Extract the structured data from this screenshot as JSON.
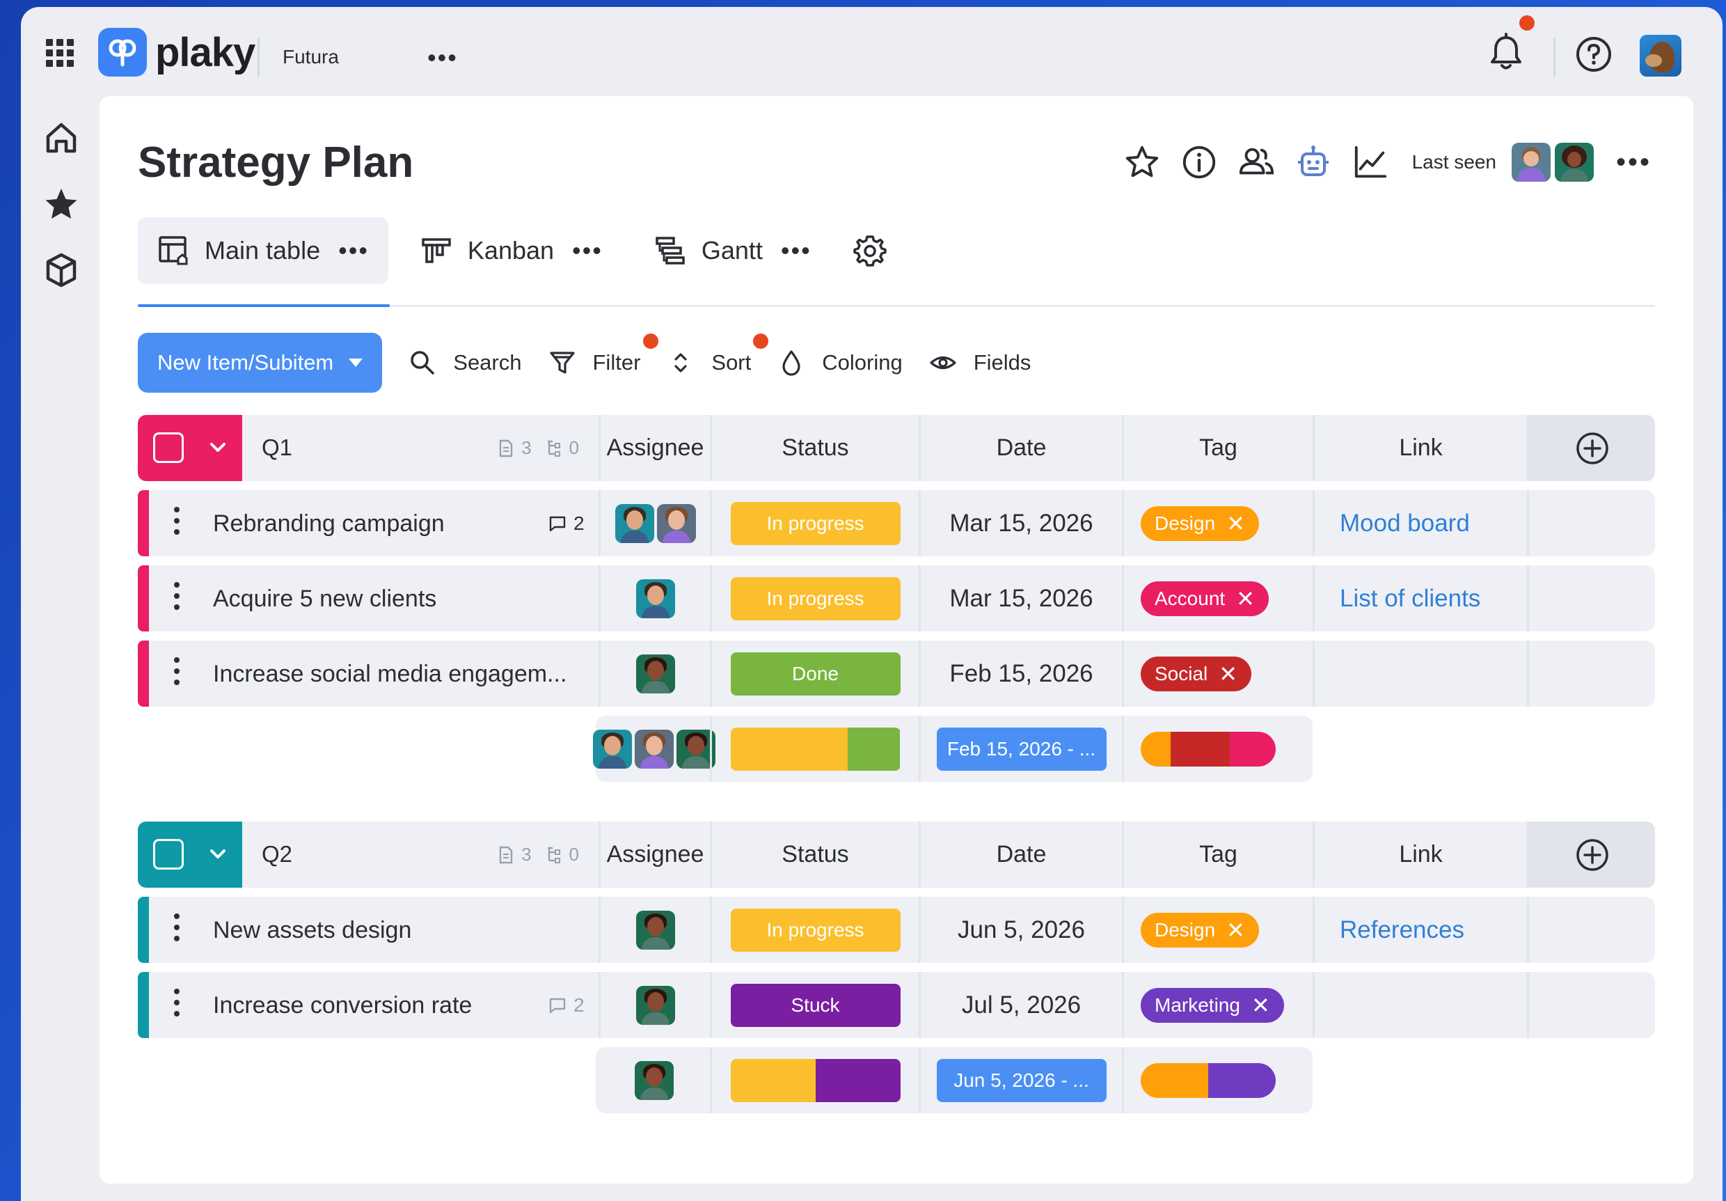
{
  "app": {
    "brand": "plaky",
    "workspace": "Futura"
  },
  "page": {
    "title": "Strategy Plan",
    "last_seen_label": "Last seen"
  },
  "views": [
    {
      "label": "Main table",
      "icon": "table-icon",
      "active": true
    },
    {
      "label": "Kanban",
      "icon": "kanban-icon",
      "active": false
    },
    {
      "label": "Gantt",
      "icon": "gantt-icon",
      "active": false
    }
  ],
  "toolbar": {
    "new_item": "New Item/Subitem",
    "search": "Search",
    "filter": "Filter",
    "sort": "Sort",
    "coloring": "Coloring",
    "fields": "Fields"
  },
  "columns": [
    "Assignee",
    "Status",
    "Date",
    "Tag",
    "Link"
  ],
  "colors": {
    "accent": "#4b8ff5",
    "in_progress": "#fbbf2e",
    "done": "#7ab540",
    "stuck": "#7b1fa2",
    "design": "#ff9f0a",
    "account": "#e91e63",
    "social": "#c62828",
    "marketing": "#6f3bc0",
    "q1": "#e91e63",
    "q2": "#0d9aa6"
  },
  "groups": [
    {
      "name": "Q1",
      "items_count": "3",
      "subitems_count": "0",
      "color": "#e91e63",
      "rows": [
        {
          "name": "Rebranding campaign",
          "comments": "2",
          "assignees": [
            "man-teal",
            "woman-purple"
          ],
          "status": "In progress",
          "status_color": "#fbbf2e",
          "date": "Mar 15, 2026",
          "tag": "Design",
          "tag_color": "#ff9f0a",
          "link": "Mood board"
        },
        {
          "name": "Acquire 5 new clients",
          "comments": "",
          "assignees": [
            "man-teal"
          ],
          "status": "In progress",
          "status_color": "#fbbf2e",
          "date": "Mar 15, 2026",
          "tag": "Account",
          "tag_color": "#e91e63",
          "link": "List of clients"
        },
        {
          "name": "Increase social media engagem...",
          "comments": "",
          "assignees": [
            "woman-green"
          ],
          "status": "Done",
          "status_color": "#7ab540",
          "date": "Feb 15, 2026",
          "tag": "Social",
          "tag_color": "#c62828",
          "link": ""
        }
      ],
      "summary": {
        "assignees": [
          "man-teal",
          "woman-purple",
          "woman-green"
        ],
        "status_split": [
          {
            "color": "#fbbf2e",
            "fraction": 0.69
          },
          {
            "color": "#7ab540",
            "fraction": 0.31
          }
        ],
        "date_range": "Feb 15, 2026 - ...",
        "tag_split": [
          {
            "color": "#ff9f0a",
            "fraction": 0.22
          },
          {
            "color": "#c62828",
            "fraction": 0.44
          },
          {
            "color": "#e91e63",
            "fraction": 0.34
          }
        ]
      }
    },
    {
      "name": "Q2",
      "items_count": "3",
      "subitems_count": "0",
      "color": "#0d9aa6",
      "rows": [
        {
          "name": "New assets design",
          "comments": "",
          "assignees": [
            "woman-green"
          ],
          "status": "In progress",
          "status_color": "#fbbf2e",
          "date": "Jun 5, 2026",
          "tag": "Design",
          "tag_color": "#ff9f0a",
          "link": "References"
        },
        {
          "name": "Increase conversion rate",
          "comments": "2",
          "assignees": [
            "woman-green"
          ],
          "status": "Stuck",
          "status_color": "#7b1fa2",
          "date": "Jul 5, 2026",
          "tag": "Marketing",
          "tag_color": "#6f3bc0",
          "link": ""
        }
      ],
      "summary": {
        "assignees": [
          "woman-green"
        ],
        "status_split": [
          {
            "color": "#fbbf2e",
            "fraction": 0.5
          },
          {
            "color": "#7b1fa2",
            "fraction": 0.5
          }
        ],
        "date_range": "Jun 5, 2026 - ...",
        "tag_split": [
          {
            "color": "#ff9f0a",
            "fraction": 0.5
          },
          {
            "color": "#6f3bc0",
            "fraction": 0.5
          }
        ]
      }
    }
  ]
}
